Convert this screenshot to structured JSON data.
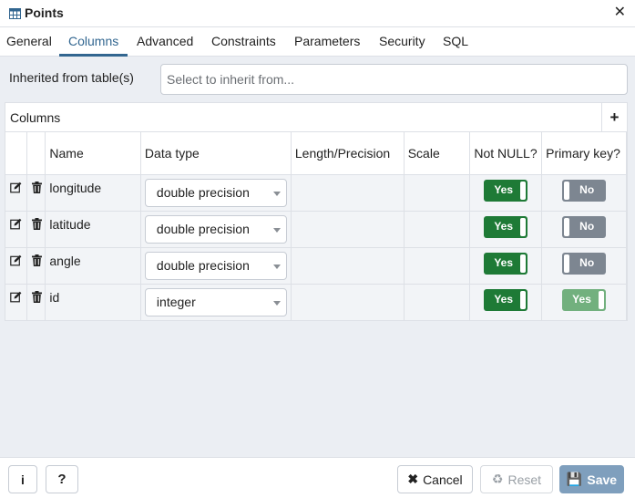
{
  "dialog": {
    "title": "Points",
    "title_icon": "table-icon",
    "close_glyph": "✕"
  },
  "tabs": [
    {
      "label": "General"
    },
    {
      "label": "Columns",
      "active": true
    },
    {
      "label": "Advanced"
    },
    {
      "label": "Constraints"
    },
    {
      "label": "Parameters"
    },
    {
      "label": "Security"
    },
    {
      "label": "SQL"
    }
  ],
  "inherit": {
    "label": "Inherited from table(s)",
    "placeholder": "Select to inherit from..."
  },
  "columns_grid": {
    "title": "Columns",
    "add_glyph": "+",
    "headers": {
      "name": "Name",
      "data_type": "Data type",
      "length": "Length/Precision",
      "scale": "Scale",
      "not_null": "Not NULL?",
      "primary_key": "Primary key?"
    },
    "rows": [
      {
        "name": "longitude",
        "data_type": "double precision",
        "length": "",
        "scale": "",
        "not_null": "Yes",
        "primary_key": "No"
      },
      {
        "name": "latitude",
        "data_type": "double precision",
        "length": "",
        "scale": "",
        "not_null": "Yes",
        "primary_key": "No"
      },
      {
        "name": "angle",
        "data_type": "double precision",
        "length": "",
        "scale": "",
        "not_null": "Yes",
        "primary_key": "No"
      },
      {
        "name": "id",
        "data_type": "integer",
        "length": "",
        "scale": "",
        "not_null": "Yes",
        "primary_key": "Yes"
      }
    ]
  },
  "footer": {
    "info_glyph": "i",
    "help_glyph": "?",
    "cancel_label": "Cancel",
    "cancel_icon": "✖",
    "reset_label": "Reset",
    "reset_icon": "♻",
    "save_label": "Save",
    "save_icon": "💾"
  },
  "colors": {
    "accent": "#326690",
    "toggle_on": "#1e7a36",
    "toggle_off": "#7d8691",
    "toggle_on_light": "#72b07e",
    "save_button": "#7f9fbd"
  }
}
